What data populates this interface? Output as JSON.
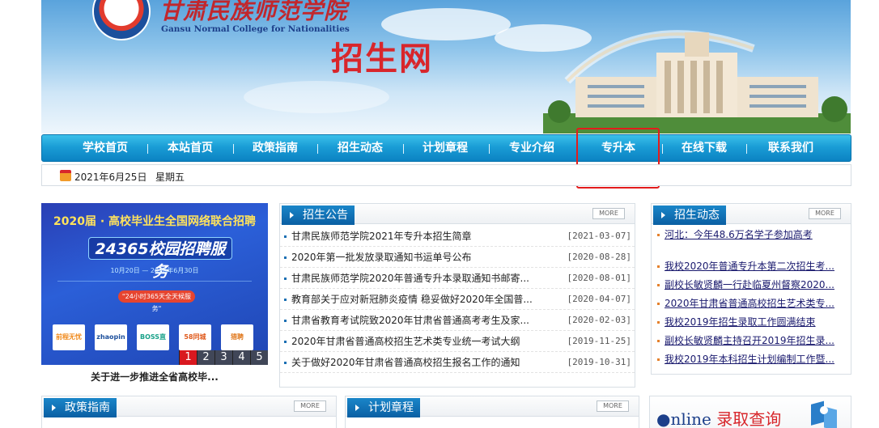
{
  "banner": {
    "school_name_cn": "甘肃民族师范学院",
    "school_name_en": "Gansu Normal College for Nationalities",
    "site_title": "招生网"
  },
  "nav": {
    "items": [
      "学校首页",
      "本站首页",
      "政策指南",
      "招生动态",
      "计划章程",
      "专业介绍",
      "专升本",
      "在线下载",
      "联系我们"
    ],
    "highlighted": "专升本"
  },
  "datebar": {
    "date": "2021年6月25日",
    "weekday": "星期五"
  },
  "slider": {
    "headline": "2020届 · 高校毕业生全国网络联合招聘",
    "title": "24365校园招聘服务",
    "date_range": "10月20日 — 2020年6月30日",
    "pill": "\"24小时365天全天候服务\"",
    "tiles": [
      "前程无忧",
      "zhaopin",
      "BOSS直聘",
      "58同城",
      "猎聘"
    ],
    "pager": [
      "1",
      "2",
      "3",
      "4",
      "5"
    ],
    "active_page": "1",
    "caption": "关于进一步推进全省高校毕..."
  },
  "notices": {
    "title": "招生公告",
    "more": "MORE",
    "items": [
      {
        "text": "甘肃民族师范学院2021年专升本招生简章",
        "date": "[2021-03-07]"
      },
      {
        "text": "2020年第一批发放录取通知书运单号公布",
        "date": "[2020-08-28]"
      },
      {
        "text": "甘肃民族师范学院2020年普通专升本录取通知书邮寄...",
        "date": "[2020-08-01]"
      },
      {
        "text": "教育部关于应对新冠肺炎疫情 稳妥做好2020年全国普...",
        "date": "[2020-04-07]"
      },
      {
        "text": "甘肃省教育考试院致2020年甘肃省普通高考考生及家...",
        "date": "[2020-02-03]"
      },
      {
        "text": "2020年甘肃省普通高校招生艺术类专业统一考试大纲",
        "date": "[2019-11-25]"
      },
      {
        "text": "关于做好2020年甘肃省普通高校招生报名工作的通知",
        "date": "[2019-10-31]"
      }
    ]
  },
  "dynamics": {
    "title": "招生动态",
    "more": "MORE",
    "items": [
      "河北：今年48.6万名学子参加高考",
      "我校2020年普通专升本第二次招生考...",
      "副校长敏贤麟一行赴临夏州督察2020...",
      "2020年甘肃省普通高校招生艺术类专...",
      "我校2019年招生录取工作圆满结束",
      "副校长敏贤麟主持召开2019年招生录...",
      "我校2019年本科招生计划编制工作暨..."
    ]
  },
  "policy": {
    "title": "政策指南",
    "more": "MORE"
  },
  "plans": {
    "title": "计划章程",
    "more": "MORE"
  },
  "online": {
    "en": "●nline",
    "cn": "录取查询"
  }
}
